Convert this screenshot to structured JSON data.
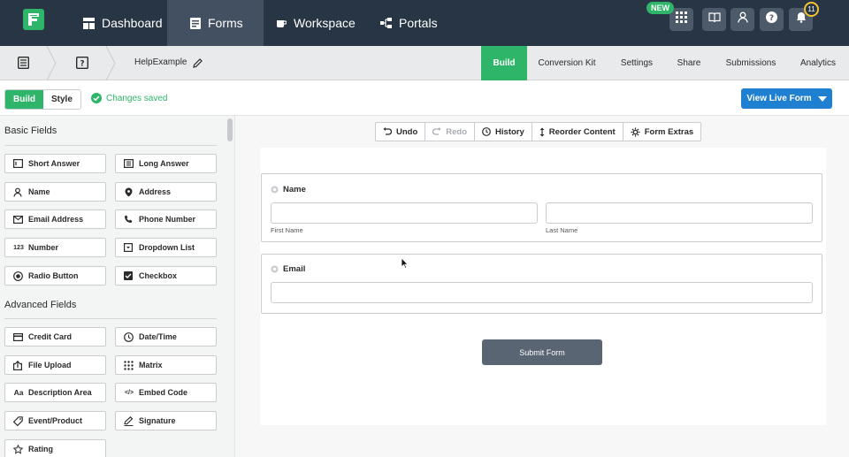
{
  "topnav": {
    "items": [
      {
        "label": "Dashboard",
        "icon": "dashboard-icon"
      },
      {
        "label": "Forms",
        "icon": "forms-icon"
      },
      {
        "label": "Workspace",
        "icon": "workspace-icon"
      },
      {
        "label": "Portals",
        "icon": "portals-icon"
      }
    ],
    "new_badge": "NEW",
    "notifications_count": "11"
  },
  "subbar": {
    "form_name": "HelpExample",
    "tabs": [
      "Build",
      "Conversion Kit",
      "Settings",
      "Share",
      "Submissions",
      "Analytics"
    ]
  },
  "toolbar": {
    "mode_build": "Build",
    "mode_style": "Style",
    "status": "Changes saved",
    "live_button": "View Live Form"
  },
  "fields": {
    "basic_title": "Basic Fields",
    "basic": [
      {
        "label": "Short Answer",
        "icon": "short-answer-icon"
      },
      {
        "label": "Long Answer",
        "icon": "long-answer-icon"
      },
      {
        "label": "Name",
        "icon": "person-icon"
      },
      {
        "label": "Address",
        "icon": "map-pin-icon"
      },
      {
        "label": "Email Address",
        "icon": "envelope-icon"
      },
      {
        "label": "Phone Number",
        "icon": "phone-icon"
      },
      {
        "label": "Number",
        "icon": "number-icon",
        "glyph": "123"
      },
      {
        "label": "Dropdown List",
        "icon": "dropdown-icon"
      },
      {
        "label": "Radio Button",
        "icon": "radio-icon"
      },
      {
        "label": "Checkbox",
        "icon": "checkbox-icon"
      }
    ],
    "advanced_title": "Advanced Fields",
    "advanced": [
      {
        "label": "Credit Card",
        "icon": "credit-card-icon"
      },
      {
        "label": "Date/Time",
        "icon": "clock-icon"
      },
      {
        "label": "File Upload",
        "icon": "upload-icon"
      },
      {
        "label": "Matrix",
        "icon": "matrix-icon"
      },
      {
        "label": "Description Area",
        "icon": "text-icon",
        "glyph": "Aa"
      },
      {
        "label": "Embed Code",
        "icon": "code-icon",
        "glyph": "</>"
      },
      {
        "label": "Event/Product",
        "icon": "tag-icon"
      },
      {
        "label": "Signature",
        "icon": "pen-icon"
      },
      {
        "label": "Rating",
        "icon": "star-icon"
      }
    ]
  },
  "canvas_toolbar": {
    "undo": "Undo",
    "redo": "Redo",
    "history": "History",
    "reorder": "Reorder Content",
    "extras": "Form Extras"
  },
  "form": {
    "name_label": "Name",
    "first_name": "First Name",
    "last_name": "Last Name",
    "email_label": "Email",
    "submit": "Submit Form"
  },
  "colors": {
    "nav_bg": "#283544",
    "accent_green": "#2fb56a",
    "accent_blue": "#1f7fd1"
  }
}
